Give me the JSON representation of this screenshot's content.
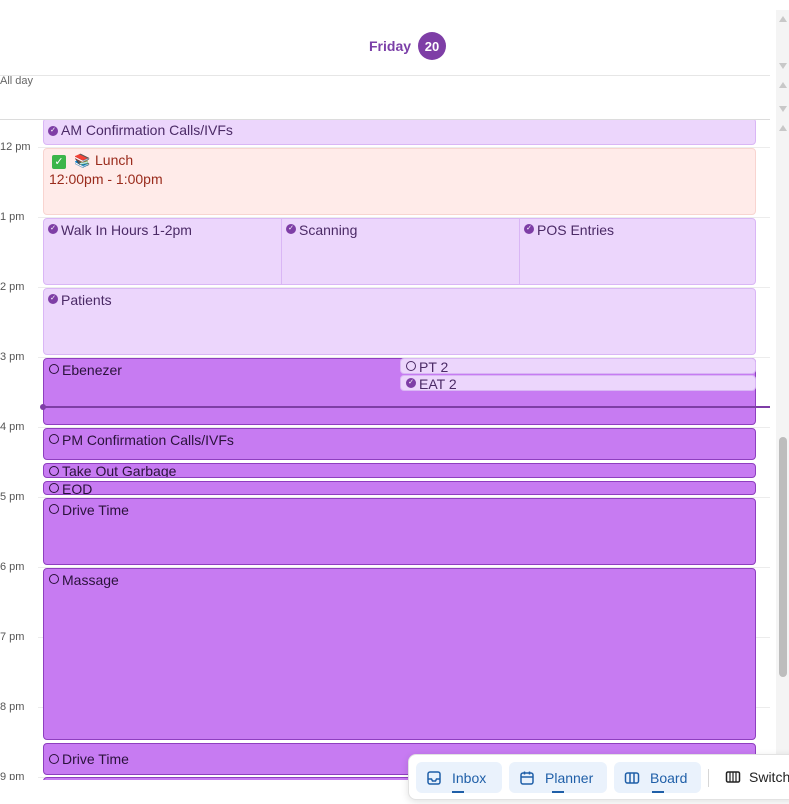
{
  "header": {
    "day_name": "Friday",
    "day_number": "20",
    "all_day_label": "All day"
  },
  "hours": [
    "12 pm",
    "1 pm",
    "2 pm",
    "3 pm",
    "4 pm",
    "5 pm",
    "6 pm",
    "7 pm",
    "8 pm",
    "9 pm"
  ],
  "events": {
    "am_confirmation": {
      "title": "AM Confirmation Calls/IVFs",
      "status": "done"
    },
    "lunch": {
      "title": "Lunch",
      "time": "12:00pm - 1:00pm",
      "emoji": "📚"
    },
    "walk_in": {
      "title": "Walk In Hours 1-2pm",
      "status": "done"
    },
    "scanning": {
      "title": "Scanning",
      "status": "done"
    },
    "pos_entries": {
      "title": "POS Entries",
      "status": "done"
    },
    "patients": {
      "title": "Patients",
      "status": "done"
    },
    "ebenezer": {
      "title": "Ebenezer",
      "status": "open"
    },
    "pt2": {
      "title": "PT 2",
      "status": "open"
    },
    "eat2": {
      "title": "EAT 2",
      "status": "done"
    },
    "pm_confirmation": {
      "title": "PM Confirmation Calls/IVFs",
      "status": "open"
    },
    "take_out_garbage": {
      "title": "Take Out Garbage",
      "status": "open"
    },
    "eod": {
      "title": "EOD",
      "status": "open"
    },
    "drive_time_1": {
      "title": "Drive Time",
      "status": "open"
    },
    "massage": {
      "title": "Massage",
      "status": "open"
    },
    "drive_time_2": {
      "title": "Drive Time",
      "status": "open"
    }
  },
  "toolbar": {
    "inbox": "Inbox",
    "planner": "Planner",
    "board": "Board",
    "switch": "Switch"
  },
  "colors": {
    "accent": "#7e3ea6",
    "event_light": "#ecd6fc",
    "event_dark": "#c77bf2",
    "lunch_bg": "#ffebe9",
    "toolbar_blue": "#1f5fa8"
  }
}
